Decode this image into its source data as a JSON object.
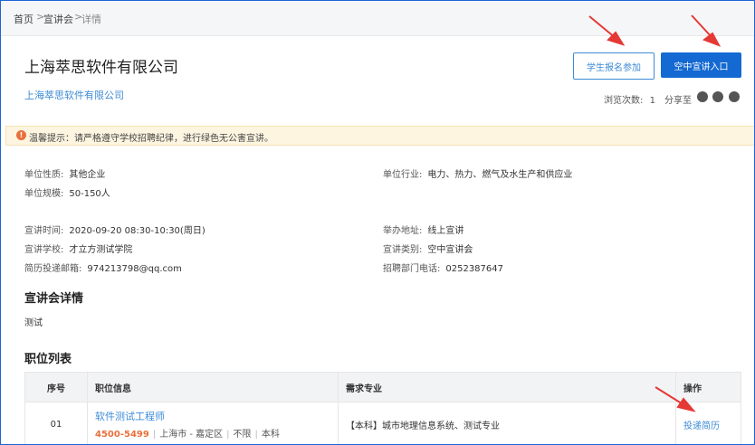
{
  "breadcrumb": {
    "home": "首页",
    "sep1": ">",
    "list": "宣讲会",
    "sep2": ">",
    "current": "详情"
  },
  "company": {
    "title": "上海萃思软件有限公司",
    "link": "上海萃思软件有限公司"
  },
  "actions": {
    "register": "学生报名参加",
    "online_entry": "空中宣讲入口"
  },
  "stats": {
    "views_label": "浏览次数:",
    "views": "1",
    "share_label": "分享至"
  },
  "share_icons": [
    "wechat-icon",
    "qq-icon",
    "weibo-icon"
  ],
  "notice": {
    "icon": "!",
    "text": "温馨提示：请严格遵守学校招聘纪律，进行绿色无公害宣讲。"
  },
  "info": {
    "nature_label": "单位性质:",
    "nature": "其他企业",
    "industry_label": "单位行业:",
    "industry": "电力、热力、燃气及水生产和供应业",
    "scale_label": "单位规模:",
    "scale": "50-150人",
    "time_label": "宣讲时间:",
    "time": "2020-09-20 08:30-10:30(周日)",
    "address_label": "举办地址:",
    "address": "线上宣讲",
    "school_label": "宣讲学校:",
    "school": "才立方测试学院",
    "category_label": "宣讲类别:",
    "category": "空中宣讲会",
    "email_label": "简历投递邮箱:",
    "email": "974213798@qq.com",
    "phone_label": "招聘部门电话:",
    "phone": "0252387647"
  },
  "details": {
    "heading": "宣讲会详情",
    "text": "测试"
  },
  "jobs": {
    "heading": "职位列表",
    "columns": [
      "序号",
      "职位信息",
      "需求专业",
      "操作"
    ],
    "rows": [
      {
        "no": "01",
        "name": "软件测试工程师",
        "salary": "4500-5499",
        "location": "上海市 - 嘉定区",
        "experience": "不限",
        "degree": "本科",
        "major": "【本科】城市地理信息系统、测试专业",
        "action": "投递简历"
      }
    ]
  },
  "colors": {
    "primary": "#1469d2",
    "link": "#3d8bd6",
    "salary": "#e9703d",
    "annotation": "#e53935"
  }
}
